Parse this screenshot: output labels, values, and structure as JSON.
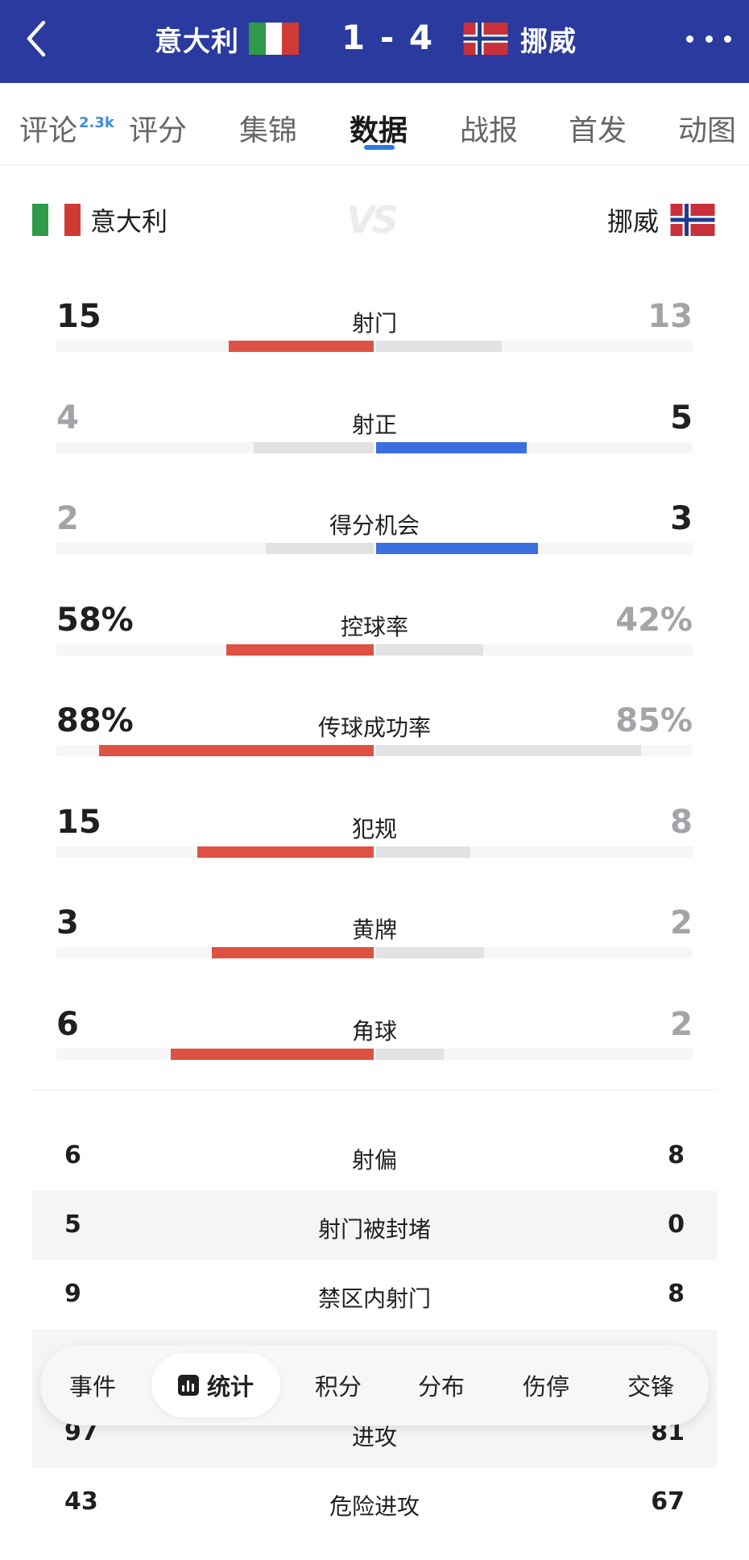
{
  "header": {
    "home_team": "意大利",
    "away_team": "挪威",
    "score": "1 - 4"
  },
  "tabs": [
    {
      "label": "评论",
      "badge": "2.3k"
    },
    {
      "label": "评分"
    },
    {
      "label": "集锦"
    },
    {
      "label": "数据",
      "active": true
    },
    {
      "label": "战报"
    },
    {
      "label": "首发"
    },
    {
      "label": "动图"
    }
  ],
  "teams": {
    "home": "意大利",
    "away": "挪威",
    "vs": "VS"
  },
  "bar_stats": [
    {
      "label": "射门",
      "home": "15",
      "away": "13",
      "lead": "home"
    },
    {
      "label": "射正",
      "home": "4",
      "away": "5",
      "lead": "away"
    },
    {
      "label": "得分机会",
      "home": "2",
      "away": "3",
      "lead": "away"
    },
    {
      "label": "控球率",
      "home": "58%",
      "away": "42%",
      "lead": "home"
    },
    {
      "label": "传球成功率",
      "home": "88%",
      "away": "85%",
      "lead": "home"
    },
    {
      "label": "犯规",
      "home": "15",
      "away": "8",
      "lead": "home"
    },
    {
      "label": "黄牌",
      "home": "3",
      "away": "2",
      "lead": "home"
    },
    {
      "label": "角球",
      "home": "6",
      "away": "2",
      "lead": "home"
    }
  ],
  "list_stats": [
    {
      "label": "射偏",
      "home": "6",
      "away": "8"
    },
    {
      "label": "射门被封堵",
      "home": "5",
      "away": "0"
    },
    {
      "label": "禁区内射门",
      "home": "9",
      "away": "8"
    },
    {
      "label": "进攻",
      "home": "97",
      "away": "81"
    },
    {
      "label": "危险进攻",
      "home": "43",
      "away": "67"
    }
  ],
  "bottom_tabs": [
    {
      "label": "事件"
    },
    {
      "label": "统计",
      "active": true,
      "icon": "bar-chart-icon"
    },
    {
      "label": "积分"
    },
    {
      "label": "分布"
    },
    {
      "label": "伤停"
    },
    {
      "label": "交锋"
    }
  ],
  "colors": {
    "header_bg": "#2a3a9e",
    "home_bar": "#de5244",
    "away_bar": "#3b6fe0",
    "neutral_bar": "#e2e2e4",
    "lead_text": "#1f1f1f",
    "trail_text": "#a3a3a8",
    "italy_green": "#2e9a4a",
    "italy_red": "#d03a35",
    "norway_red": "#c8313a",
    "norway_blue": "#1e3b8e"
  }
}
